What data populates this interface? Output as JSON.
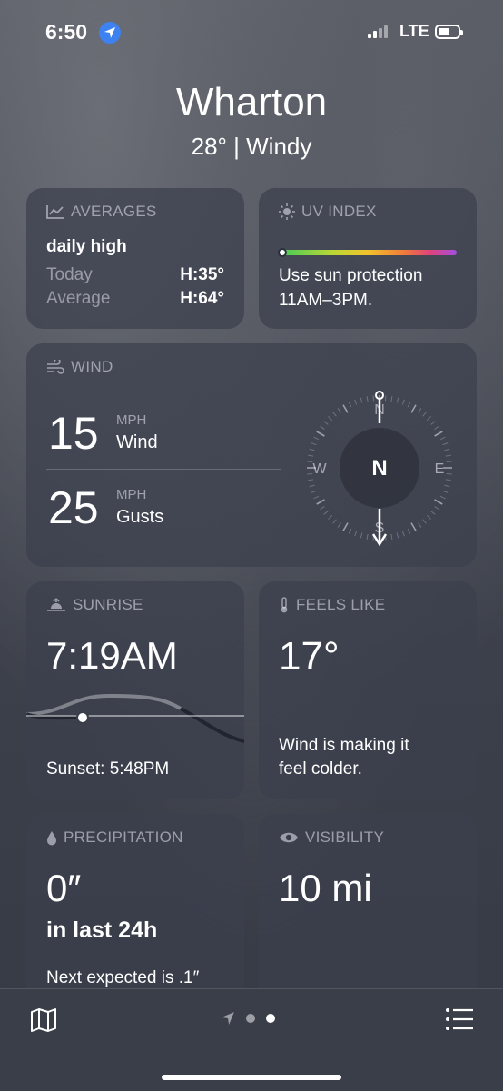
{
  "status": {
    "time": "6:50",
    "network": "LTE"
  },
  "header": {
    "city": "Wharton",
    "condition": "28°  |  Windy"
  },
  "averages": {
    "title": "AVERAGES",
    "subtitle": "daily high",
    "today_label": "Today",
    "today_value": "H:35°",
    "average_label": "Average",
    "average_value": "H:64°"
  },
  "uv": {
    "title": "UV INDEX",
    "level": 0.0,
    "line1": "Use sun protection",
    "line2": "11AM–3PM."
  },
  "wind": {
    "title": "WIND",
    "wind_value": "15",
    "wind_unit": "MPH",
    "wind_label": "Wind",
    "gust_value": "25",
    "gust_unit": "MPH",
    "gust_label": "Gusts",
    "compass": {
      "n": "N",
      "s": "S",
      "e": "E",
      "w": "W",
      "center": "N"
    }
  },
  "sunrise": {
    "title": "SUNRISE",
    "time": "7:19AM",
    "sunset": "Sunset: 5:48PM"
  },
  "feels": {
    "title": "FEELS LIKE",
    "value": "17°",
    "line1": "Wind is making it",
    "line2": "feel colder."
  },
  "precip": {
    "title": "PRECIPITATION",
    "value": "0″",
    "period": "in last 24h",
    "next": "Next expected is .1″"
  },
  "visibility": {
    "title": "VISIBILITY",
    "value": "10 mi"
  },
  "icons": [
    "location-arrow-icon",
    "chart-icon",
    "sun-icon",
    "wind-icon",
    "sunrise-icon",
    "thermometer-icon",
    "drop-icon",
    "eye-icon",
    "map-icon",
    "list-icon"
  ]
}
